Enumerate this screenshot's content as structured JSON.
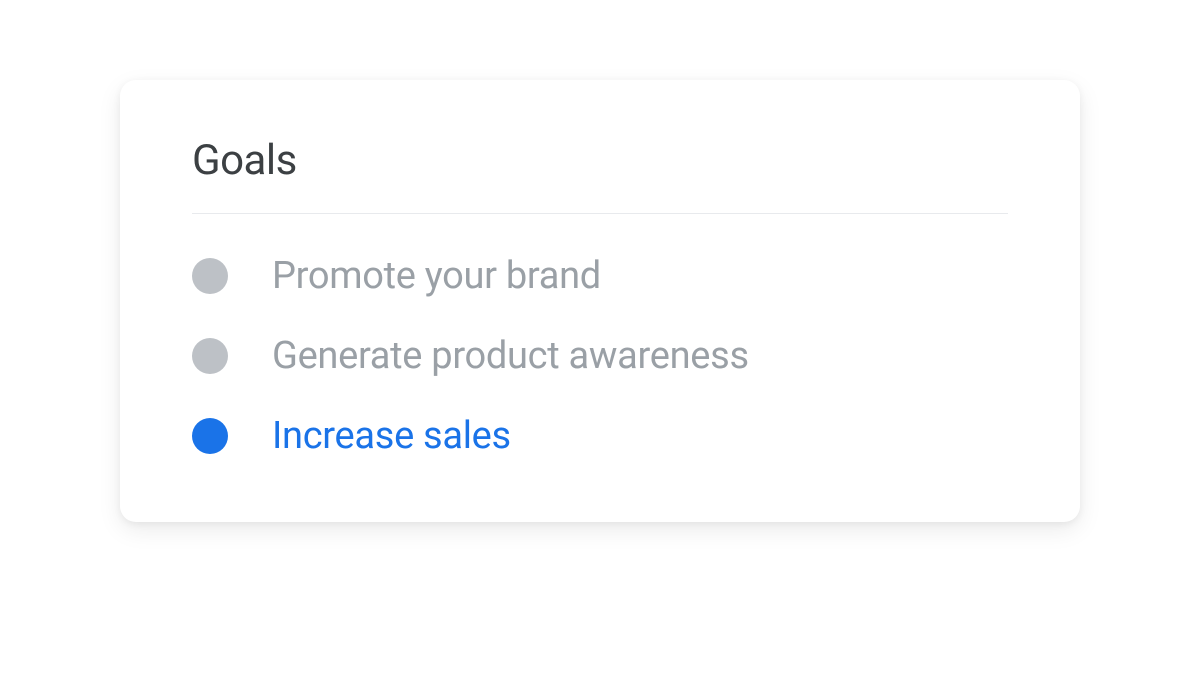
{
  "card": {
    "title": "Goals",
    "options": [
      {
        "label": "Promote your brand",
        "selected": false
      },
      {
        "label": "Generate product awareness",
        "selected": false
      },
      {
        "label": "Increase sales",
        "selected": true
      }
    ]
  },
  "colors": {
    "accent": "#1a73e8",
    "muted": "#bdc1c6",
    "text_muted": "#9aa0a6",
    "text_title": "#3c4043",
    "divider": "#e8eaed"
  }
}
